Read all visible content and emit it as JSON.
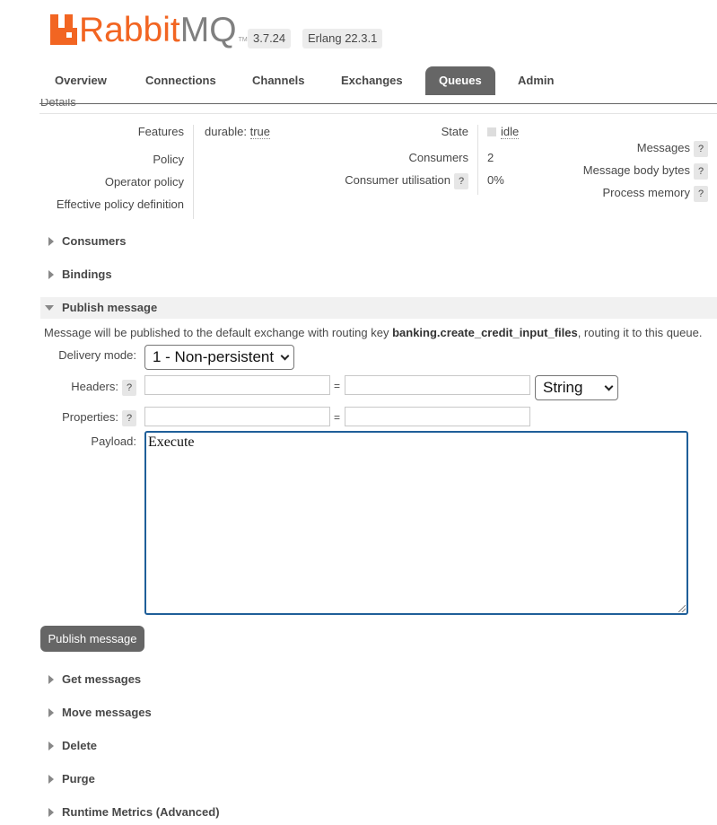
{
  "header": {
    "logo_rabbit": "Rabbit",
    "logo_mq": "MQ",
    "logo_tm": "TM",
    "version": "3.7.24",
    "erlang": "Erlang 22.3.1"
  },
  "nav": {
    "tabs": [
      "Overview",
      "Connections",
      "Channels",
      "Exchanges",
      "Queues",
      "Admin"
    ],
    "active": "Queues"
  },
  "details": {
    "heading": "Details",
    "features_label": "Features",
    "features_key": "durable:",
    "features_value": "true",
    "policy_label": "Policy",
    "operator_policy_label": "Operator policy",
    "effective_policy_label": "Effective policy definition",
    "state_label": "State",
    "state_value": "idle",
    "consumers_label": "Consumers",
    "consumers_value": "2",
    "consumer_util_label": "Consumer utilisation",
    "consumer_util_value": "0%",
    "messages_label": "Messages",
    "message_body_bytes_label": "Message body bytes",
    "process_memory_label": "Process memory",
    "help": "?"
  },
  "sections": {
    "consumers": "Consumers",
    "bindings": "Bindings",
    "publish": "Publish message",
    "get": "Get messages",
    "move": "Move messages",
    "delete": "Delete",
    "purge": "Purge",
    "runtime": "Runtime Metrics (Advanced)"
  },
  "publish": {
    "notice_pre": "Message will be published to the default exchange with routing key ",
    "routing_key": "banking.create_credit_input_files",
    "notice_post": ", routing it to this queue.",
    "delivery_mode_label": "Delivery mode:",
    "delivery_mode_value": "1 - Non-persistent",
    "headers_label": "Headers:",
    "header_type_value": "String",
    "properties_label": "Properties:",
    "eq": "=",
    "payload_label": "Payload:",
    "payload_value": "Execute",
    "button": "Publish message"
  }
}
